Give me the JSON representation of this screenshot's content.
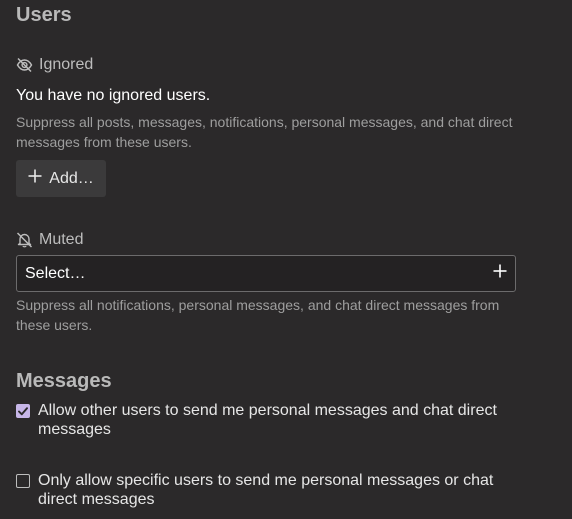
{
  "users_section": {
    "title": "Users"
  },
  "ignored": {
    "label": "Ignored",
    "icon": "eye-slash-icon",
    "empty_text": "You have no ignored users.",
    "description": "Suppress all posts, messages, notifications, personal messages, and chat direct messages from these users.",
    "add_button_label": "Add…",
    "add_icon": "plus-icon"
  },
  "muted": {
    "label": "Muted",
    "icon": "bell-slash-icon",
    "select_placeholder": "Select…",
    "select_icon": "plus-icon",
    "description": "Suppress all notifications, personal messages, and chat direct messages from these users."
  },
  "messages_section": {
    "title": "Messages",
    "options": [
      {
        "label": "Allow other users to send me personal messages and chat direct messages",
        "checked": true
      },
      {
        "label": "Only allow specific users to send me personal messages or chat direct messages",
        "checked": false
      }
    ]
  },
  "colors": {
    "background": "#2b292a",
    "accent_checkbox": "#c7b6e8",
    "button_bg": "#3b3a3b"
  }
}
